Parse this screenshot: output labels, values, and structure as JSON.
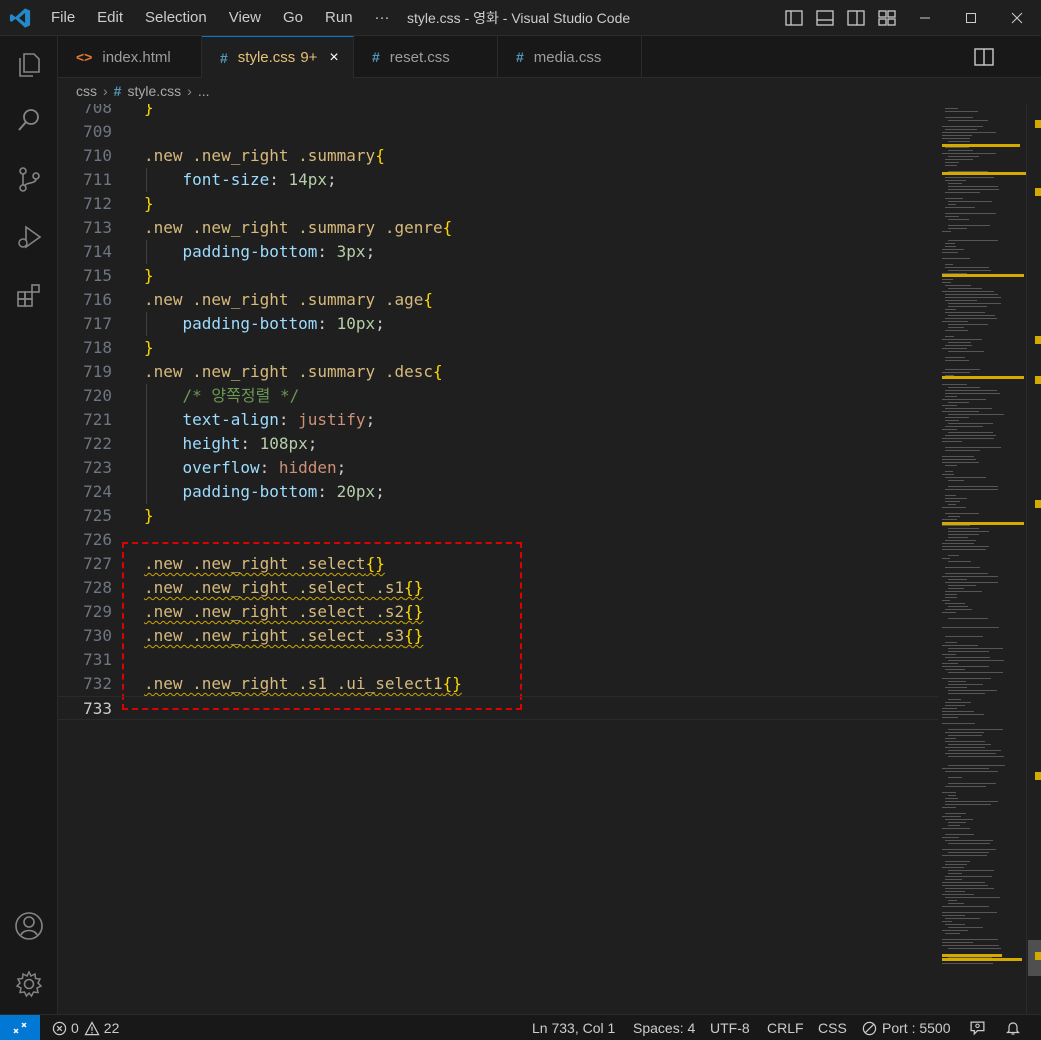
{
  "window": {
    "title": "style.css - 영화 - Visual Studio Code",
    "menu": [
      "File",
      "Edit",
      "Selection",
      "View",
      "Go",
      "Run",
      "···"
    ],
    "icons": [
      "vscode-logo-icon",
      "toggle-primary-sidebar-icon",
      "toggle-panel-icon",
      "toggle-secondary-sidebar-icon",
      "customize-layout-icon",
      "minimize-icon",
      "maximize-icon",
      "close-icon"
    ]
  },
  "tabs": [
    {
      "label": "index.html",
      "icon": "<>",
      "active": false
    },
    {
      "label": "style.css",
      "icon": "#",
      "badge": "9+",
      "active": true
    },
    {
      "label": "reset.css",
      "icon": "#",
      "active": false
    },
    {
      "label": "media.css",
      "icon": "#",
      "active": false
    }
  ],
  "tab_close": "×",
  "breadcrumb": {
    "folder": "css",
    "hash": "#",
    "file": "style.css",
    "more": "..."
  },
  "editor": {
    "lines": [
      {
        "n": "708",
        "text": "}"
      },
      {
        "n": "709",
        "text": ""
      },
      {
        "n": "710",
        "text": ".new .new_right .summary{"
      },
      {
        "n": "711",
        "text": "    font-size: 14px;"
      },
      {
        "n": "712",
        "text": "}"
      },
      {
        "n": "713",
        "text": ".new .new_right .summary .genre{"
      },
      {
        "n": "714",
        "text": "    padding-bottom: 3px;"
      },
      {
        "n": "715",
        "text": "}"
      },
      {
        "n": "716",
        "text": ".new .new_right .summary .age{"
      },
      {
        "n": "717",
        "text": "    padding-bottom: 10px;"
      },
      {
        "n": "718",
        "text": "}"
      },
      {
        "n": "719",
        "text": ".new .new_right .summary .desc{"
      },
      {
        "n": "720",
        "text": "    /* 양쪽정렬 */"
      },
      {
        "n": "721",
        "text": "    text-align: justify;"
      },
      {
        "n": "722",
        "text": "    height: 108px;"
      },
      {
        "n": "723",
        "text": "    overflow: hidden;"
      },
      {
        "n": "724",
        "text": "    padding-bottom: 20px;"
      },
      {
        "n": "725",
        "text": "}"
      },
      {
        "n": "726",
        "text": ""
      },
      {
        "n": "727",
        "text": ".new .new_right .select{}"
      },
      {
        "n": "728",
        "text": ".new .new_right .select .s1{}"
      },
      {
        "n": "729",
        "text": ".new .new_right .select .s2{}"
      },
      {
        "n": "730",
        "text": ".new .new_right .select .s3{}"
      },
      {
        "n": "731",
        "text": ""
      },
      {
        "n": "732",
        "text": ".new .new_right .s1 .ui_select1{}"
      },
      {
        "n": "733",
        "text": ""
      }
    ],
    "current_line": "733"
  },
  "status": {
    "errors": "0",
    "warnings": "22",
    "position": "Ln 733, Col 1",
    "spaces": "Spaces: 4",
    "encoding": "UTF-8",
    "eol": "CRLF",
    "language": "CSS",
    "port": "Port : 5500"
  },
  "colors": {
    "accent": "#0078d4",
    "selector": "#d7ba7d",
    "property": "#9cdcfe",
    "number": "#b5cea8",
    "string_value": "#ce9178",
    "comment": "#6a9955",
    "warning_squiggle": "#cca700",
    "annotation_box": "#e00000"
  }
}
